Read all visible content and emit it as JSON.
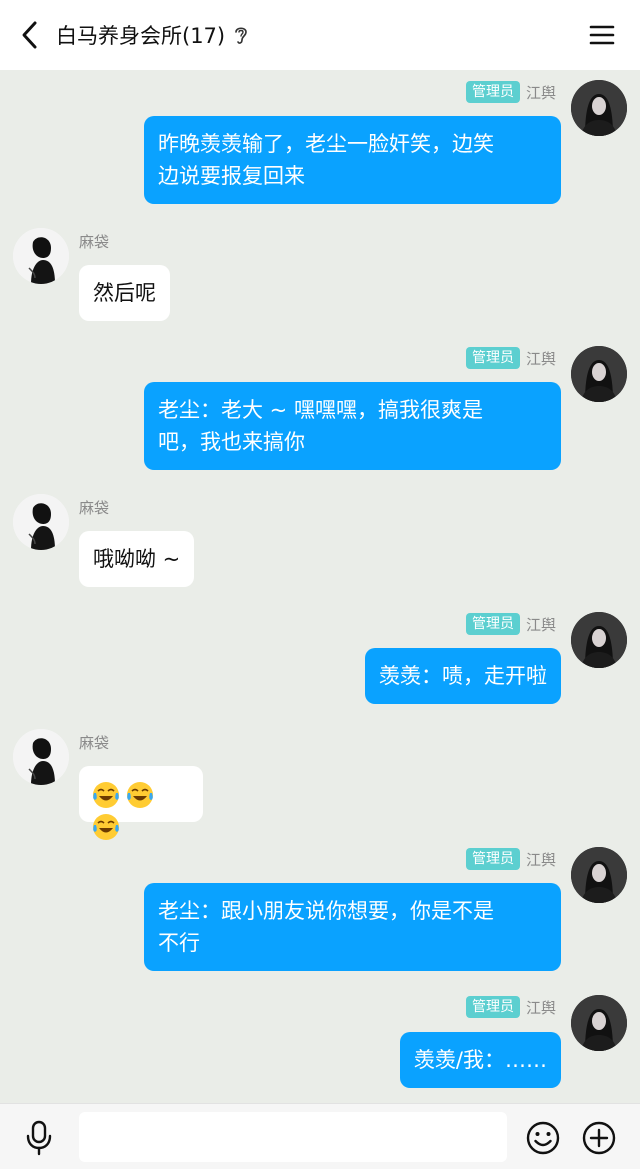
{
  "header": {
    "title": "白马养身会所(17)",
    "back_icon": "chevron-left-icon",
    "ear_icon": "ear-icon",
    "menu_icon": "menu-icon"
  },
  "colors": {
    "self_bubble": "#0aa2ff",
    "admin_badge": "#5ccfd0",
    "background": "#eaede8"
  },
  "messages": [
    {
      "side": "self",
      "badge": "管理员",
      "name": "江舆",
      "lines": [
        "昨晚羡羡输了，老尘一脸奸笑，边笑",
        "边说要报复回来"
      ]
    },
    {
      "side": "other",
      "name": "麻袋",
      "lines": [
        "然后呢"
      ]
    },
    {
      "side": "self",
      "badge": "管理员",
      "name": "江舆",
      "lines": [
        "老尘：老大 ~ 嘿嘿嘿，搞我很爽是",
        "吧，我也来搞你"
      ]
    },
    {
      "side": "other",
      "name": "麻袋",
      "lines": [
        "哦呦呦 ~"
      ]
    },
    {
      "side": "self",
      "badge": "管理员",
      "name": "江舆",
      "lines": [
        "羡羡：啧，走开啦"
      ]
    },
    {
      "side": "other",
      "name": "麻袋",
      "emoji": [
        "😂",
        "😂",
        "😂"
      ]
    },
    {
      "side": "self",
      "badge": "管理员",
      "name": "江舆",
      "lines": [
        "老尘：跟小朋友说你想要，你是不是",
        "不行"
      ]
    },
    {
      "side": "self",
      "badge": "管理员",
      "name": "江舆",
      "lines": [
        "羡羡/我：……"
      ]
    }
  ],
  "input_bar": {
    "mic_icon": "microphone-icon",
    "placeholder": "",
    "emoji_icon": "smiley-icon",
    "plus_icon": "plus-circle-icon"
  }
}
